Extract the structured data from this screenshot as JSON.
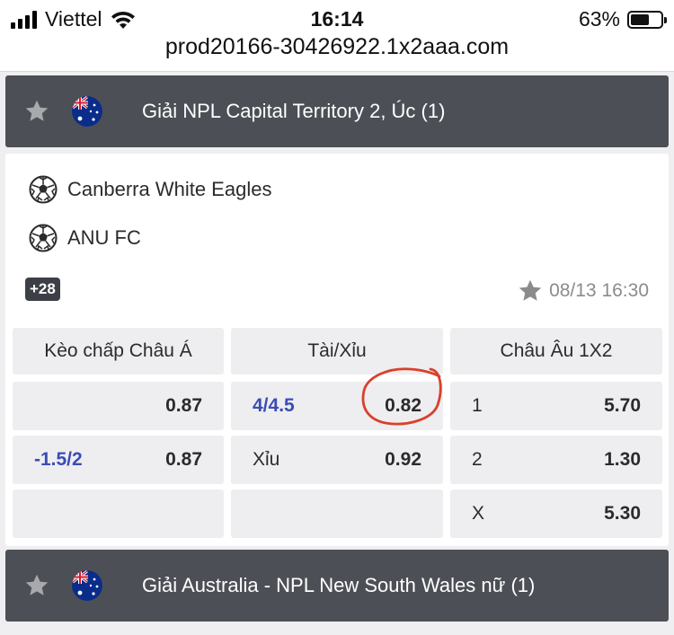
{
  "status_bar": {
    "carrier": "Viettel",
    "time": "16:14",
    "battery": "63%",
    "battery_level": 0.63,
    "url": "prod20166-30426922.1x2aaa.com"
  },
  "leagues": [
    {
      "name": "Giải NPL Capital Territory 2, Úc (1)",
      "flag": "australia-flag"
    },
    {
      "name": "Giải Australia - NPL New South Wales nữ (1)",
      "flag": "australia-flag"
    }
  ],
  "match": {
    "home": "Canberra White Eagles",
    "away": "ANU FC",
    "more_markets": "+28",
    "kickoff": "08/13 16:30"
  },
  "markets": {
    "asian_handicap": {
      "title": "Kèo chấp Châu Á",
      "rows": [
        {
          "line": "",
          "odd": "0.87"
        },
        {
          "line": "-1.5/2",
          "odd": "0.87"
        }
      ]
    },
    "over_under": {
      "title": "Tài/Xỉu",
      "rows": [
        {
          "line": "4/4.5",
          "odd": "0.82"
        },
        {
          "line": "Xỉu",
          "odd": "0.92"
        }
      ]
    },
    "europe_1x2": {
      "title": "Châu Âu 1X2",
      "rows": [
        {
          "line": "1",
          "odd": "5.70"
        },
        {
          "line": "2",
          "odd": "1.30"
        },
        {
          "line": "X",
          "odd": "5.30"
        }
      ]
    }
  },
  "colors": {
    "league_bar": "#4d4f56",
    "handicap_blue": "#3b4cb8",
    "annotation_red": "#d9402b"
  }
}
